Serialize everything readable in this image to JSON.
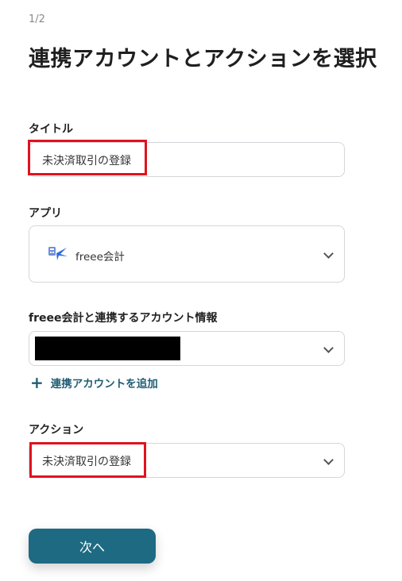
{
  "page": {
    "step": "1/2",
    "title": "連携アカウントとアクションを選択"
  },
  "form": {
    "title_label": "タイトル",
    "title_value": "未決済取引の登録",
    "app_label": "アプリ",
    "app_value": "freee会計",
    "account_label": "freee会計と連携するアカウント情報",
    "add_account_label": "連携アカウントを追加",
    "action_label": "アクション",
    "action_value": "未決済取引の登録"
  },
  "buttons": {
    "next_label": "次へ"
  },
  "icons": {
    "app_icon": "freee-logo-icon",
    "select_arrow": "chevron-down-icon",
    "add": "plus-icon"
  },
  "colors": {
    "primary": "#1e6a83",
    "link": "#1f5d74",
    "highlight": "#e0121d"
  }
}
